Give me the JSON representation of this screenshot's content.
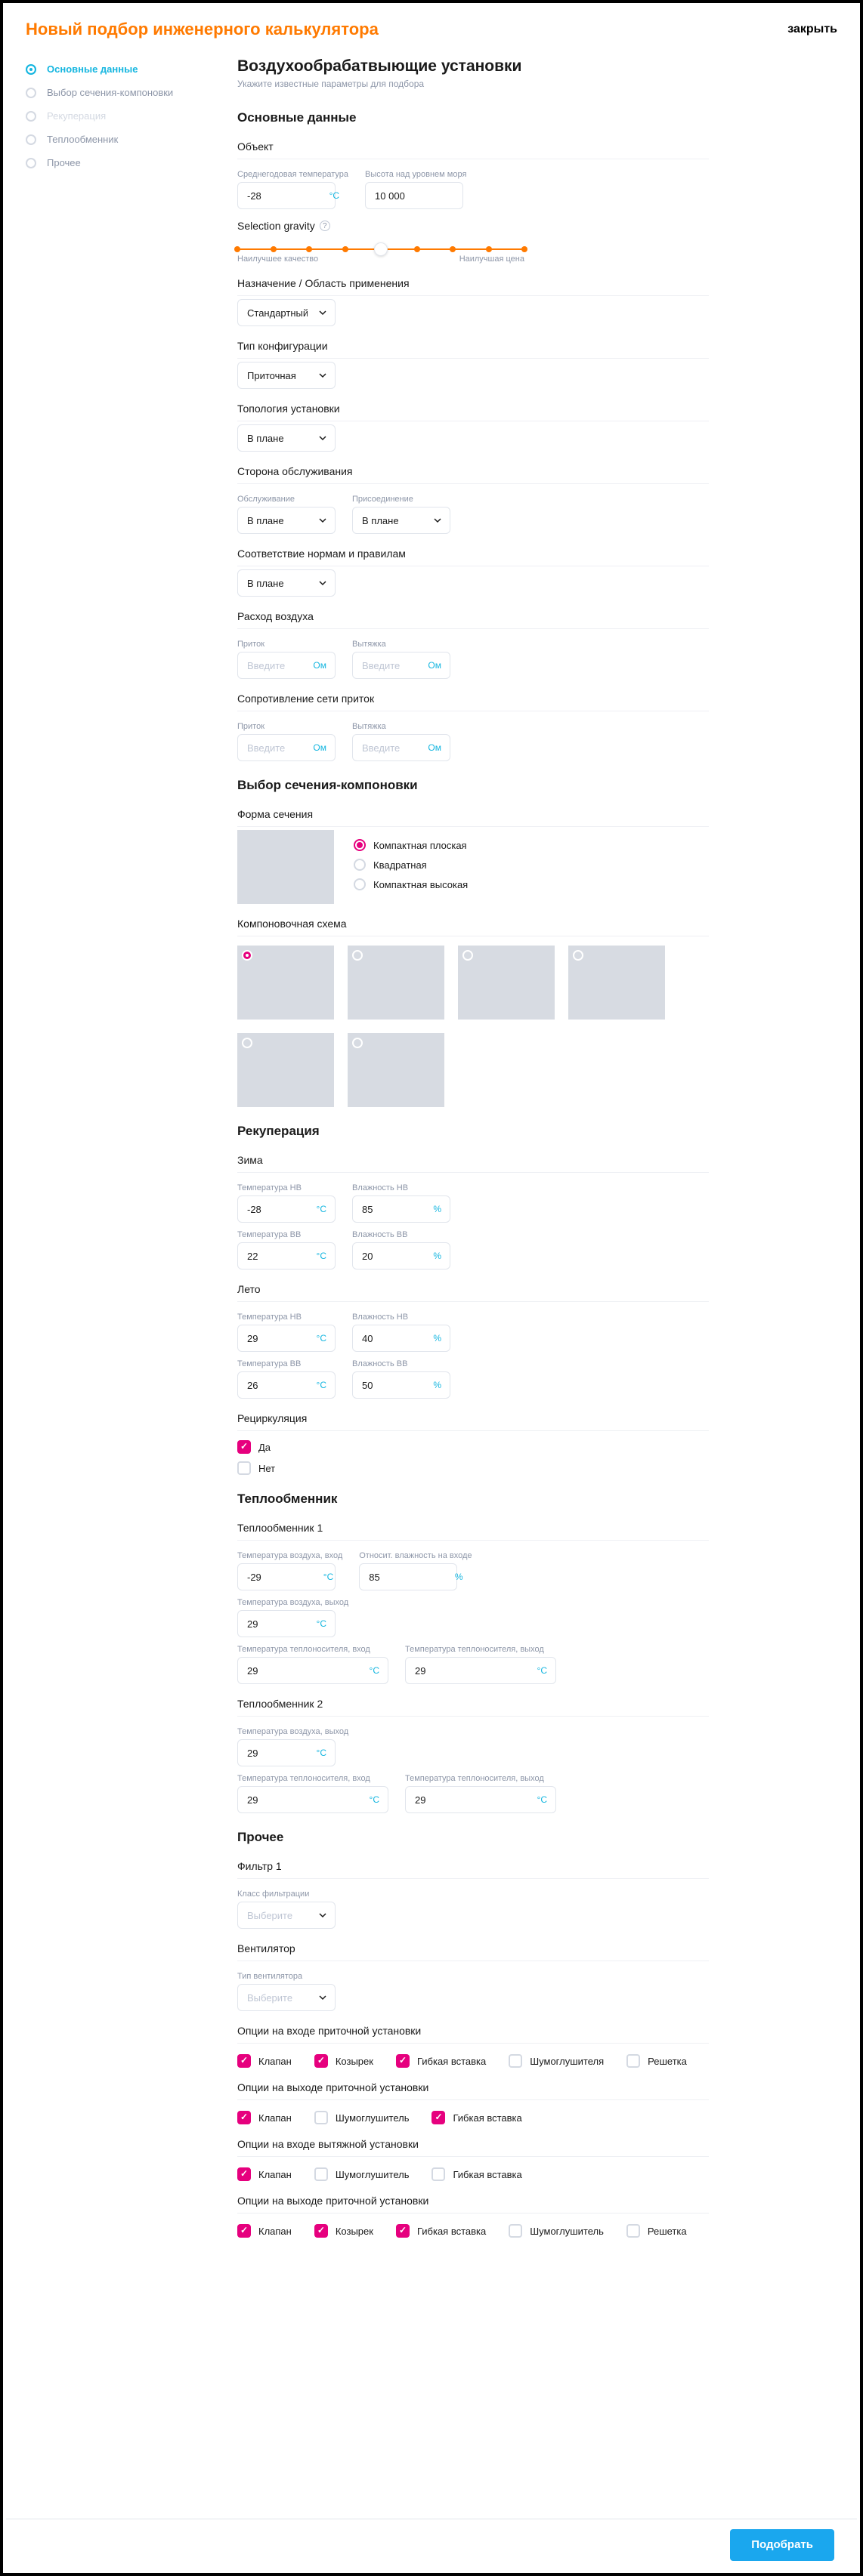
{
  "header": {
    "title": "Новый подбор инженерного калькулятора",
    "close": "закрыть"
  },
  "steps": [
    {
      "label": "Основные данные",
      "state": "active"
    },
    {
      "label": "Выбор сечения-компоновки",
      "state": ""
    },
    {
      "label": "Рекуперация",
      "state": "disabled"
    },
    {
      "label": "Теплообменник",
      "state": ""
    },
    {
      "label": "Прочее",
      "state": ""
    }
  ],
  "main_title": "Воздухообрабатвыющие установки",
  "main_subtitle": "Укажите известные параметры для подбора",
  "s1": {
    "title": "Основные данные",
    "object": {
      "group": "Объект",
      "avg_temp_label": "Среднегодовая температура",
      "avg_temp": "-28",
      "avg_temp_unit": "°C",
      "altitude_label": "Высота над уровнем моря",
      "altitude": "10 000"
    },
    "gravity": {
      "title": "Selection gravity",
      "left": "Наилучшее качество",
      "right": "Наилучшая цена"
    },
    "purpose": {
      "group": "Назначение / Область применения",
      "value": "Стандартный"
    },
    "config": {
      "group": "Тип конфигурации",
      "value": "Приточная"
    },
    "topology": {
      "group": "Топология установки",
      "value": "В плане"
    },
    "service_side": {
      "group": "Сторона обслуживания",
      "service_label": "Обслуживание",
      "service": "В плане",
      "connect_label": "Присоединение",
      "connect": "В плане"
    },
    "norms": {
      "group": "Соответствие нормам и правилам",
      "value": "В плане"
    },
    "air_flow": {
      "group": "Расход воздуха",
      "in_label": "Приток",
      "out_label": "Вытяжка",
      "placeholder": "Введите",
      "in_unit": "Ом",
      "out_unit": "Ом"
    },
    "resistance": {
      "group": "Сопротивление сети приток",
      "in_label": "Приток",
      "out_label": "Вытяжка",
      "placeholder": "Введите",
      "in_unit": "Ом",
      "out_unit": "Ом"
    }
  },
  "s2": {
    "title": "Выбор сечения-компоновки",
    "shape": {
      "group": "Форма сечения",
      "options": [
        "Компактная плоская",
        "Квадратная",
        "Компактная высокая"
      ],
      "selected": 0
    },
    "layout": {
      "group": "Компоновочная схема"
    }
  },
  "s3": {
    "title": "Рекуперация",
    "winter": {
      "group": "Зима",
      "t_nv_label": "Температура НВ",
      "t_nv": "-28",
      "t_nv_unit": "°C",
      "h_nv_label": "Влажность НВ",
      "h_nv": "85",
      "h_nv_unit": "%",
      "t_vv_label": "Температура ВВ",
      "t_vv": "22",
      "t_vv_unit": "°C",
      "h_vv_label": "Влажность ВВ",
      "h_vv": "20",
      "h_vv_unit": "%"
    },
    "summer": {
      "group": "Лето",
      "t_nv_label": "Температура НВ",
      "t_nv": "29",
      "t_nv_unit": "°C",
      "h_nv_label": "Влажность НВ",
      "h_nv": "40",
      "h_nv_unit": "%",
      "t_vv_label": "Температура ВВ",
      "t_vv": "26",
      "t_vv_unit": "°C",
      "h_vv_label": "Влажность ВВ",
      "h_vv": "50",
      "h_vv_unit": "%"
    },
    "recirc": {
      "group": "Рециркуляция",
      "yes": "Да",
      "no": "Нет"
    }
  },
  "s4": {
    "title": "Теплообменник",
    "hx1": {
      "group": "Теплообменник 1",
      "air_in_t_label": "Температура воздуха, вход",
      "air_in_t": "-29",
      "t_unit": "°C",
      "air_in_h_label": "Относит. влажность на входе",
      "air_in_h": "85",
      "h_unit": "%",
      "air_out_t_label": "Температура воздуха, выход",
      "air_out_t": "29",
      "carrier_in_t_label": "Температура теплоносителя, вход",
      "carrier_in_t": "29",
      "carrier_out_t_label": "Температура теплоносителя, выход",
      "carrier_out_t": "29"
    },
    "hx2": {
      "group": "Теплообменник 2",
      "air_out_t_label": "Температура воздуха, выход",
      "air_out_t": "29",
      "t_unit": "°C",
      "carrier_in_t_label": "Температура теплоносителя, вход",
      "carrier_in_t": "29",
      "carrier_out_t_label": "Температура теплоносителя, выход",
      "carrier_out_t": "29"
    }
  },
  "s5": {
    "title": "Прочее",
    "filter": {
      "group": "Фильтр 1",
      "class_label": "Класс фильтрации",
      "placeholder": "Выберите"
    },
    "fan": {
      "group": "Вентилятор",
      "type_label": "Тип вентилятора",
      "placeholder": "Выберите"
    },
    "opt_in_supply": {
      "group": "Опции на входе приточной установки",
      "items": [
        {
          "label": "Клапан",
          "checked": true
        },
        {
          "label": "Козырек",
          "checked": true
        },
        {
          "label": "Гибкая вставка",
          "checked": true
        },
        {
          "label": "Шумоглушителя",
          "checked": false
        },
        {
          "label": "Решетка",
          "checked": false
        }
      ]
    },
    "opt_out_supply": {
      "group": "Опции на выходе приточной установки",
      "items": [
        {
          "label": "Клапан",
          "checked": true
        },
        {
          "label": "Шумоглушитель",
          "checked": false
        },
        {
          "label": "Гибкая вставка",
          "checked": true
        }
      ]
    },
    "opt_in_exhaust": {
      "group": "Опции на входе вытяжной установки",
      "items": [
        {
          "label": "Клапан",
          "checked": true
        },
        {
          "label": "Шумоглушитель",
          "checked": false
        },
        {
          "label": "Гибкая вставка",
          "checked": false
        }
      ]
    },
    "opt_out_supply2": {
      "group": "Опции на выходе приточной установки",
      "items": [
        {
          "label": "Клапан",
          "checked": true
        },
        {
          "label": "Козырек",
          "checked": true
        },
        {
          "label": "Гибкая вставка",
          "checked": true
        },
        {
          "label": "Шумоглушитель",
          "checked": false
        },
        {
          "label": "Решетка",
          "checked": false
        }
      ]
    }
  },
  "footer": {
    "submit": "Подобрать"
  }
}
